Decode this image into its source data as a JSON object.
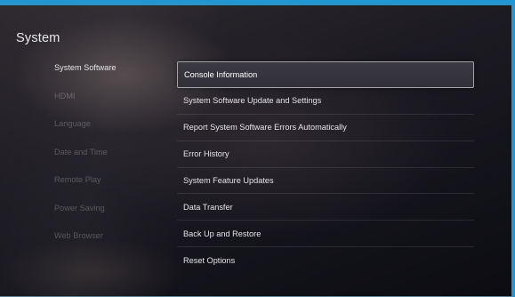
{
  "header": {
    "title": "System"
  },
  "sidebar": {
    "items": [
      {
        "label": "System Software",
        "active": true
      },
      {
        "label": "HDMI",
        "active": false
      },
      {
        "label": "Language",
        "active": false
      },
      {
        "label": "Date and Time",
        "active": false
      },
      {
        "label": "Remote Play",
        "active": false
      },
      {
        "label": "Power Saving",
        "active": false
      },
      {
        "label": "Web Browser",
        "active": false
      }
    ]
  },
  "main": {
    "items": [
      {
        "label": "Console Information",
        "selected": true
      },
      {
        "label": "System Software Update and Settings",
        "selected": false
      },
      {
        "label": "Report System Software Errors Automatically",
        "selected": false
      },
      {
        "label": "Error History",
        "selected": false
      },
      {
        "label": "System Feature Updates",
        "selected": false
      },
      {
        "label": "Data Transfer",
        "selected": false
      },
      {
        "label": "Back Up and Restore",
        "selected": false
      },
      {
        "label": "Reset Options",
        "selected": false
      }
    ]
  },
  "colors": {
    "frame": "#2196d4",
    "text_primary": "#e6e6ea",
    "text_dim": "rgba(255,255,255,0.24)",
    "selection_border": "#ffffff"
  }
}
